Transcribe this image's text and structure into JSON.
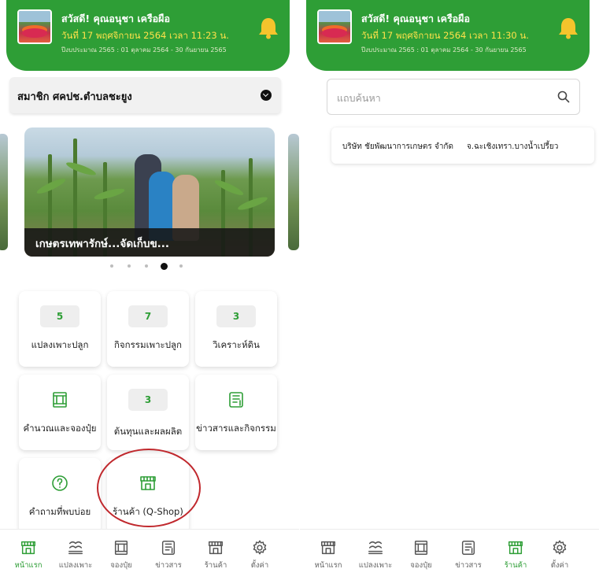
{
  "header": {
    "greeting": "สวัสดี! คุณอนุชา เครือผือ",
    "budget_year": "ปีงบประมาณ 2565 : 01 ตุลาคม 2564 - 30 กันยายน 2565"
  },
  "left_screen": {
    "datetime": "วันที่ 17 พฤศจิกายน 2564 เวลา 11:23 น.",
    "member_select": "สมาชิก ศคปช.ตำบลชะยูง",
    "carousel": {
      "caption": "เกษตรเทพารักษ์...จัดเก็บข...",
      "dot_count": 5,
      "active_index": 3
    },
    "tiles": [
      {
        "count": "5",
        "label": "แปลงเพาะปลูก"
      },
      {
        "count": "7",
        "label": "กิจกรรมเพาะปลูก"
      },
      {
        "count": "3",
        "label": "วิเคราะห์ดิน"
      },
      {
        "icon": "fertilizer-icon",
        "label": "คำนวณและจองปุ๋ย"
      },
      {
        "count": "3",
        "label": "ต้นทุนและผลผลิต"
      },
      {
        "icon": "news-icon",
        "label": "ข่าวสารและกิจกรรม"
      },
      {
        "icon": "question-icon",
        "label": "คำถามที่พบบ่อย"
      },
      {
        "icon": "shop-icon",
        "label": "ร้านค้า (Q-Shop)"
      }
    ],
    "active_nav": "หน้าแรก"
  },
  "right_screen": {
    "datetime": "วันที่ 17 พฤศจิกายน 2564 เวลา 11:30 น.",
    "search": {
      "placeholder": "แถบค้นหา",
      "value": ""
    },
    "results": [
      {
        "name": "บริษัท ชัยพัฒนาการเกษตร จำกัด",
        "location": "จ.ฉะเชิงเทรา.บางน้ำเปรี้ยว"
      }
    ],
    "active_nav": "ร้านค้า"
  },
  "bottom_nav": [
    {
      "icon": "shop-icon",
      "label": "หน้าแรก"
    },
    {
      "icon": "plot-icon",
      "label": "แปลงเพาะ"
    },
    {
      "icon": "fertilizer-icon",
      "label": "จองปุ๋ย"
    },
    {
      "icon": "news-icon",
      "label": "ข่าวสาร"
    },
    {
      "icon": "shop-icon",
      "label": "ร้านค้า"
    },
    {
      "icon": "gear-icon",
      "label": "ตั้งค่า"
    }
  ],
  "colors": {
    "primary_green": "#2e9e36",
    "datetime_yellow": "#ffe24a",
    "bell_yellow": "#f5c42c",
    "highlight_red": "#c0282d"
  }
}
